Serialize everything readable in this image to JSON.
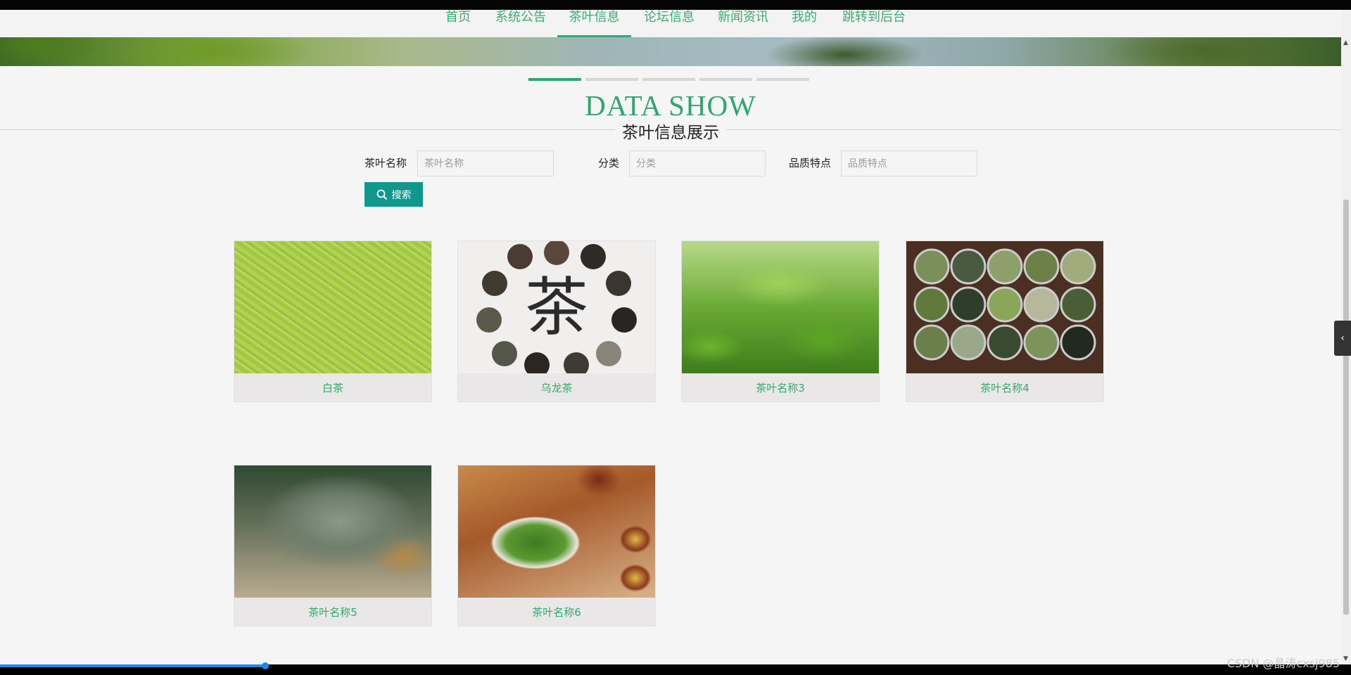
{
  "nav": {
    "items": [
      {
        "label": "首页",
        "active": false
      },
      {
        "label": "系统公告",
        "active": false
      },
      {
        "label": "茶叶信息",
        "active": true
      },
      {
        "label": "论坛信息",
        "active": false
      },
      {
        "label": "新闻资讯",
        "active": false
      },
      {
        "label": "我的",
        "active": false
      },
      {
        "label": "跳转到后台",
        "active": false
      }
    ]
  },
  "section": {
    "title": "DATA SHOW",
    "subtitle": "茶叶信息展示"
  },
  "search": {
    "fields": [
      {
        "label": "茶叶名称",
        "placeholder": "茶叶名称"
      },
      {
        "label": "分类",
        "placeholder": "分类"
      },
      {
        "label": "品质特点",
        "placeholder": "品质特点"
      }
    ],
    "button_label": "搜索"
  },
  "cards": [
    {
      "name": "白茶"
    },
    {
      "name": "乌龙茶"
    },
    {
      "name": "茶叶名称3"
    },
    {
      "name": "茶叶名称4"
    },
    {
      "name": "茶叶名称5"
    },
    {
      "name": "茶叶名称6"
    }
  ],
  "watermark": "CSDN @晶涛cxsj985",
  "colors": {
    "accent": "#2fa66f",
    "button": "#10978e",
    "card_bg": "#e9e7e8"
  },
  "icons": {
    "search_button_icon": "search-icon",
    "side_tab_icon": "chevron-left-icon"
  }
}
